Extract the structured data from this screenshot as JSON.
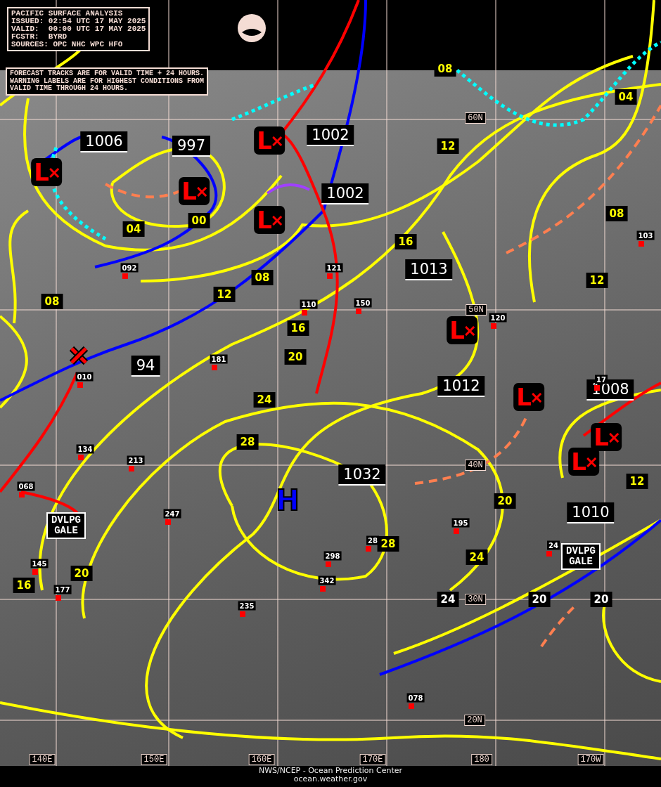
{
  "header": {
    "lines": [
      "PACIFIC SURFACE ANALYSIS",
      "ISSUED: 02:54 UTC 17 MAY 2025",
      "VALID:  00:00 UTC 17 MAY 2025",
      "FCSTR:  BYRD",
      "SOURCES: OPC NHC WPC HFO"
    ]
  },
  "notice": {
    "lines": [
      "FORECAST TRACKS ARE FOR VALID TIME + 24 HOURS.",
      "WARNING LABELS ARE FOR HIGHEST CONDITIONS FROM",
      "VALID TIME THROUGH 24 HOURS."
    ]
  },
  "pressure_labels": [
    "1006",
    "997",
    "1002",
    "1002",
    "1013",
    "94",
    "1012",
    "1008",
    "1032",
    "1010"
  ],
  "isobar_labels": [
    {
      "text": "08",
      "kind": "yellow"
    },
    {
      "text": "04",
      "kind": "yellow"
    },
    {
      "text": "12",
      "kind": "yellow"
    },
    {
      "text": "04",
      "kind": "yellow"
    },
    {
      "text": "00",
      "kind": "yellow"
    },
    {
      "text": "08",
      "kind": "yellow"
    },
    {
      "text": "16",
      "kind": "yellow"
    },
    {
      "text": "12",
      "kind": "yellow"
    },
    {
      "text": "08",
      "kind": "yellow"
    },
    {
      "text": "12",
      "kind": "yellow"
    },
    {
      "text": "08",
      "kind": "yellow"
    },
    {
      "text": "16",
      "kind": "yellow"
    },
    {
      "text": "20",
      "kind": "yellow"
    },
    {
      "text": "24",
      "kind": "yellow"
    },
    {
      "text": "28",
      "kind": "yellow"
    },
    {
      "text": "12",
      "kind": "yellow"
    },
    {
      "text": "20",
      "kind": "yellow"
    },
    {
      "text": "28",
      "kind": "yellow"
    },
    {
      "text": "24",
      "kind": "yellow"
    },
    {
      "text": "20",
      "kind": "yellow"
    },
    {
      "text": "16",
      "kind": "yellow"
    },
    {
      "text": "24",
      "kind": "white"
    },
    {
      "text": "20",
      "kind": "white"
    },
    {
      "text": "20",
      "kind": "white"
    }
  ],
  "stations": [
    "092",
    "121",
    "110",
    "150",
    "120",
    "103",
    "181",
    "010",
    "134",
    "213",
    "068",
    "247",
    "145",
    "177",
    "298",
    "28",
    "342",
    "235",
    "195",
    "24",
    "17",
    "078"
  ],
  "lows": [
    "L",
    "L",
    "L",
    "L",
    "L",
    "L",
    "L",
    "L"
  ],
  "highs": [
    "H"
  ],
  "warnings": [
    {
      "lines": [
        "DVLPG",
        "GALE"
      ]
    },
    {
      "lines": [
        "DVLPG",
        "GALE"
      ]
    }
  ],
  "latitudes": [
    "60N",
    "50N",
    "40N",
    "30N",
    "20N"
  ],
  "longitudes": [
    "140E",
    "150E",
    "160E",
    "170E",
    "180",
    "170W"
  ],
  "footer": {
    "lines": [
      "NWS/NCEP - Ocean Prediction Center",
      "ocean.weather.gov"
    ]
  }
}
